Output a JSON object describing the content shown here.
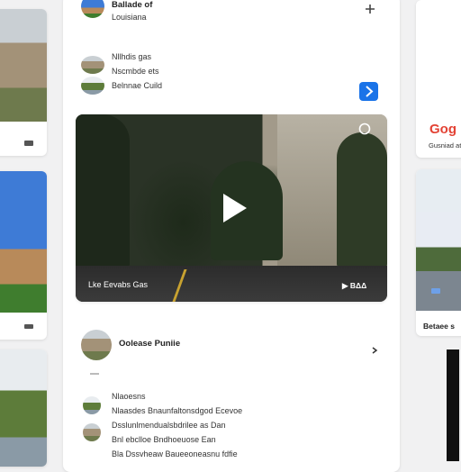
{
  "feed": {
    "post1": {
      "title": "Ballade of",
      "subtitle": "Louisiana"
    },
    "post2": {
      "lines": [
        "Nllhdis gas",
        "Nscmbde ets",
        "Belnnae Cuild"
      ],
      "action_icon": "arrow-right-icon",
      "action_color": "#1a73e8"
    },
    "video": {
      "caption": "Lke Eevabs Gas",
      "badge": "▶ ΒΔΔ"
    },
    "place": {
      "title": "Oolease Puniie"
    },
    "comments": {
      "header": "Nlaoesns",
      "items": [
        "Nlaasdes Bnaunfaltonsdgod Ecevoe",
        "Dsslunlmendualsbdrilee as Dan",
        "Bnl ebclloe Bndhoeuose Ean",
        "Bla Dssvheaw Baueeoneasnu fdfie"
      ]
    }
  },
  "right": {
    "logo": "Gog",
    "sub": "Gusniad at",
    "caption": "Betaee s"
  },
  "colors": {
    "accent": "#1a73e8",
    "google_red": "#e34234"
  }
}
